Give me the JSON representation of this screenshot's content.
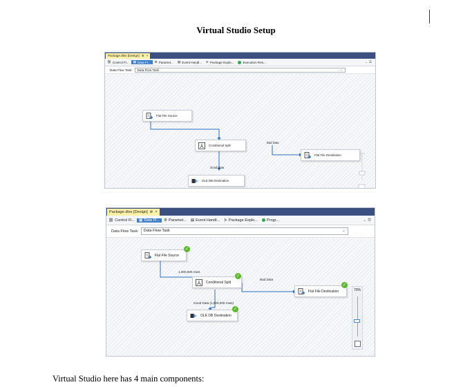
{
  "document": {
    "title": "Virtual Studio Setup",
    "paragraph": "Virtual Studio here has 4 main components:"
  },
  "screenshot_1": {
    "doc_tab": "Package.dtsx [Design]",
    "toolbar_tabs": [
      {
        "label": "Control Fl...",
        "active": false
      },
      {
        "label": "Data Fl...",
        "active": true
      },
      {
        "label": "Paramet...",
        "active": false
      },
      {
        "label": "Event Handl...",
        "active": false
      },
      {
        "label": "Package Explo...",
        "active": false
      },
      {
        "label": "Execution Res...",
        "active": false
      }
    ],
    "task_label": "Data Flow Task:",
    "task_value": "Data Flow Task",
    "nodes": {
      "source": "Flat File Source",
      "split": "Conditional Split",
      "flat_dest": "Flat File Destination",
      "oledb_dest": "OLE DB Destination"
    },
    "path_labels": {
      "bad": "Bad Data",
      "good": "Good Data"
    }
  },
  "screenshot_2": {
    "doc_tab": "Package.dtsx [Design]",
    "toolbar_tabs": [
      {
        "label": "Control Fl...",
        "active": false
      },
      {
        "label": "Data Fl...",
        "active": true
      },
      {
        "label": "Paramet...",
        "active": false
      },
      {
        "label": "Event Handl...",
        "active": false
      },
      {
        "label": "Package Explo...",
        "active": false
      },
      {
        "label": "Progr...",
        "active": false
      }
    ],
    "task_label": "Data Flow Task:",
    "task_value": "Data Flow Task",
    "nodes": {
      "source": "Flat File Source",
      "split": "Conditional Split",
      "flat_dest": "Flat File Destination",
      "oledb_dest": "OLE DB Destination"
    },
    "path_labels": {
      "source_rows": "1,000,000 rows",
      "bad": "Bad Data",
      "good": "Good Data (1,000,000 rows)"
    },
    "zoom_level": "70%",
    "status": {
      "success_color": "#5cb82c",
      "accent": "#3d7fc8",
      "tabbar": "#3b4f81",
      "doc_tab": "#fff1a8"
    }
  }
}
